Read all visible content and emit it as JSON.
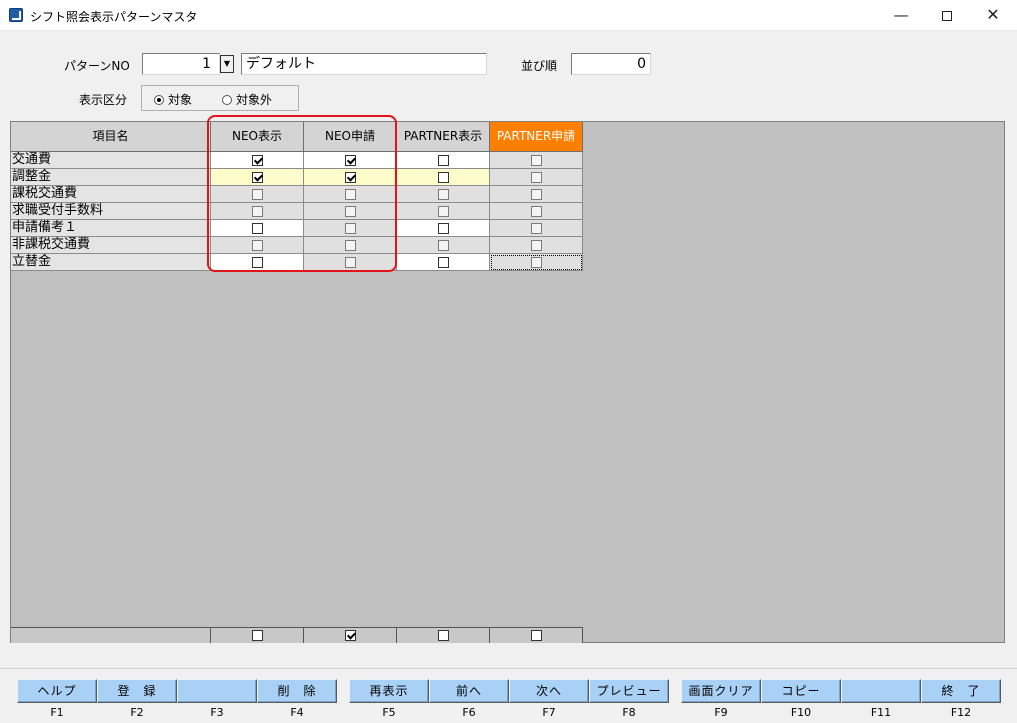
{
  "window": {
    "title": "シフト照会表示パターンマスタ"
  },
  "form": {
    "pattern_no_label": "パターンNO",
    "pattern_no_value": "1",
    "pattern_name_value": "デフォルト",
    "sort_label": "並び順",
    "sort_value": "0",
    "display_label": "表示区分",
    "radio_target": "対象",
    "radio_non_target": "対象外"
  },
  "grid": {
    "headers": [
      "項目名",
      "NEO表示",
      "NEO申請",
      "PARTNER表示",
      "PARTNER申請"
    ],
    "rows": [
      {
        "name": "交通費",
        "checks": [
          true,
          true,
          false,
          false
        ]
      },
      {
        "name": "調整金",
        "checks": [
          true,
          true,
          false,
          false
        ]
      },
      {
        "name": "課税交通費",
        "checks": [
          false,
          false,
          false,
          false
        ]
      },
      {
        "name": "求職受付手数料",
        "checks": [
          false,
          false,
          false,
          false
        ]
      },
      {
        "name": "申請備考１",
        "checks": [
          false,
          false,
          false,
          false
        ]
      },
      {
        "name": "非課税交通費",
        "checks": [
          false,
          false,
          false,
          false
        ]
      },
      {
        "name": "立替金",
        "checks": [
          false,
          false,
          false,
          false
        ]
      }
    ],
    "footer_checks": [
      false,
      true,
      false,
      false
    ]
  },
  "fkeys": [
    {
      "label": "ヘルプ",
      "key": "F1"
    },
    {
      "label": "登　録",
      "key": "F2"
    },
    {
      "label": "",
      "key": "F3"
    },
    {
      "label": "削　除",
      "key": "F4"
    },
    {
      "label": "再表示",
      "key": "F5"
    },
    {
      "label": "前へ",
      "key": "F6"
    },
    {
      "label": "次へ",
      "key": "F7"
    },
    {
      "label": "プレビュー",
      "key": "F8"
    },
    {
      "label": "画面クリア",
      "key": "F9"
    },
    {
      "label": "コピー",
      "key": "F10"
    },
    {
      "label": "",
      "key": "F11"
    },
    {
      "label": "終　了",
      "key": "F12"
    }
  ],
  "colors": {
    "accent_header": "#ff7f00",
    "fkey_blue": "#a9d0f5",
    "highlight_row": "#fffccc",
    "annotation": "#e0141a"
  }
}
